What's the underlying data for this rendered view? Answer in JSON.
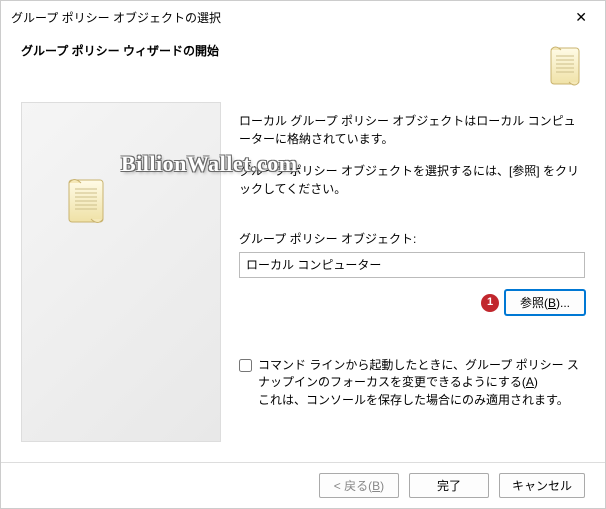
{
  "titlebar": {
    "title": "グループ ポリシー オブジェクトの選択"
  },
  "header": {
    "heading": "グループ ポリシー ウィザードの開始"
  },
  "watermark": "BillionWallet.com",
  "content": {
    "desc1": "ローカル グループ ポリシー オブジェクトはローカル コンピューターに格納されています。",
    "desc2": "グループ ポリシー オブジェクトを選択するには、[参照] をクリックしてください。",
    "field_label": "グループ ポリシー オブジェクト:",
    "field_value": "ローカル コンピューター",
    "browse_label": "参照(B)...",
    "badge": "1",
    "checkbox_label": "コマンド ラインから起動したときに、グループ ポリシー スナップインのフォーカスを変更できるようにする(A)",
    "checkbox_note": "これは、コンソールを保存した場合にのみ適用されます。"
  },
  "footer": {
    "back": "< 戻る(B)",
    "finish": "完了",
    "cancel": "キャンセル"
  }
}
